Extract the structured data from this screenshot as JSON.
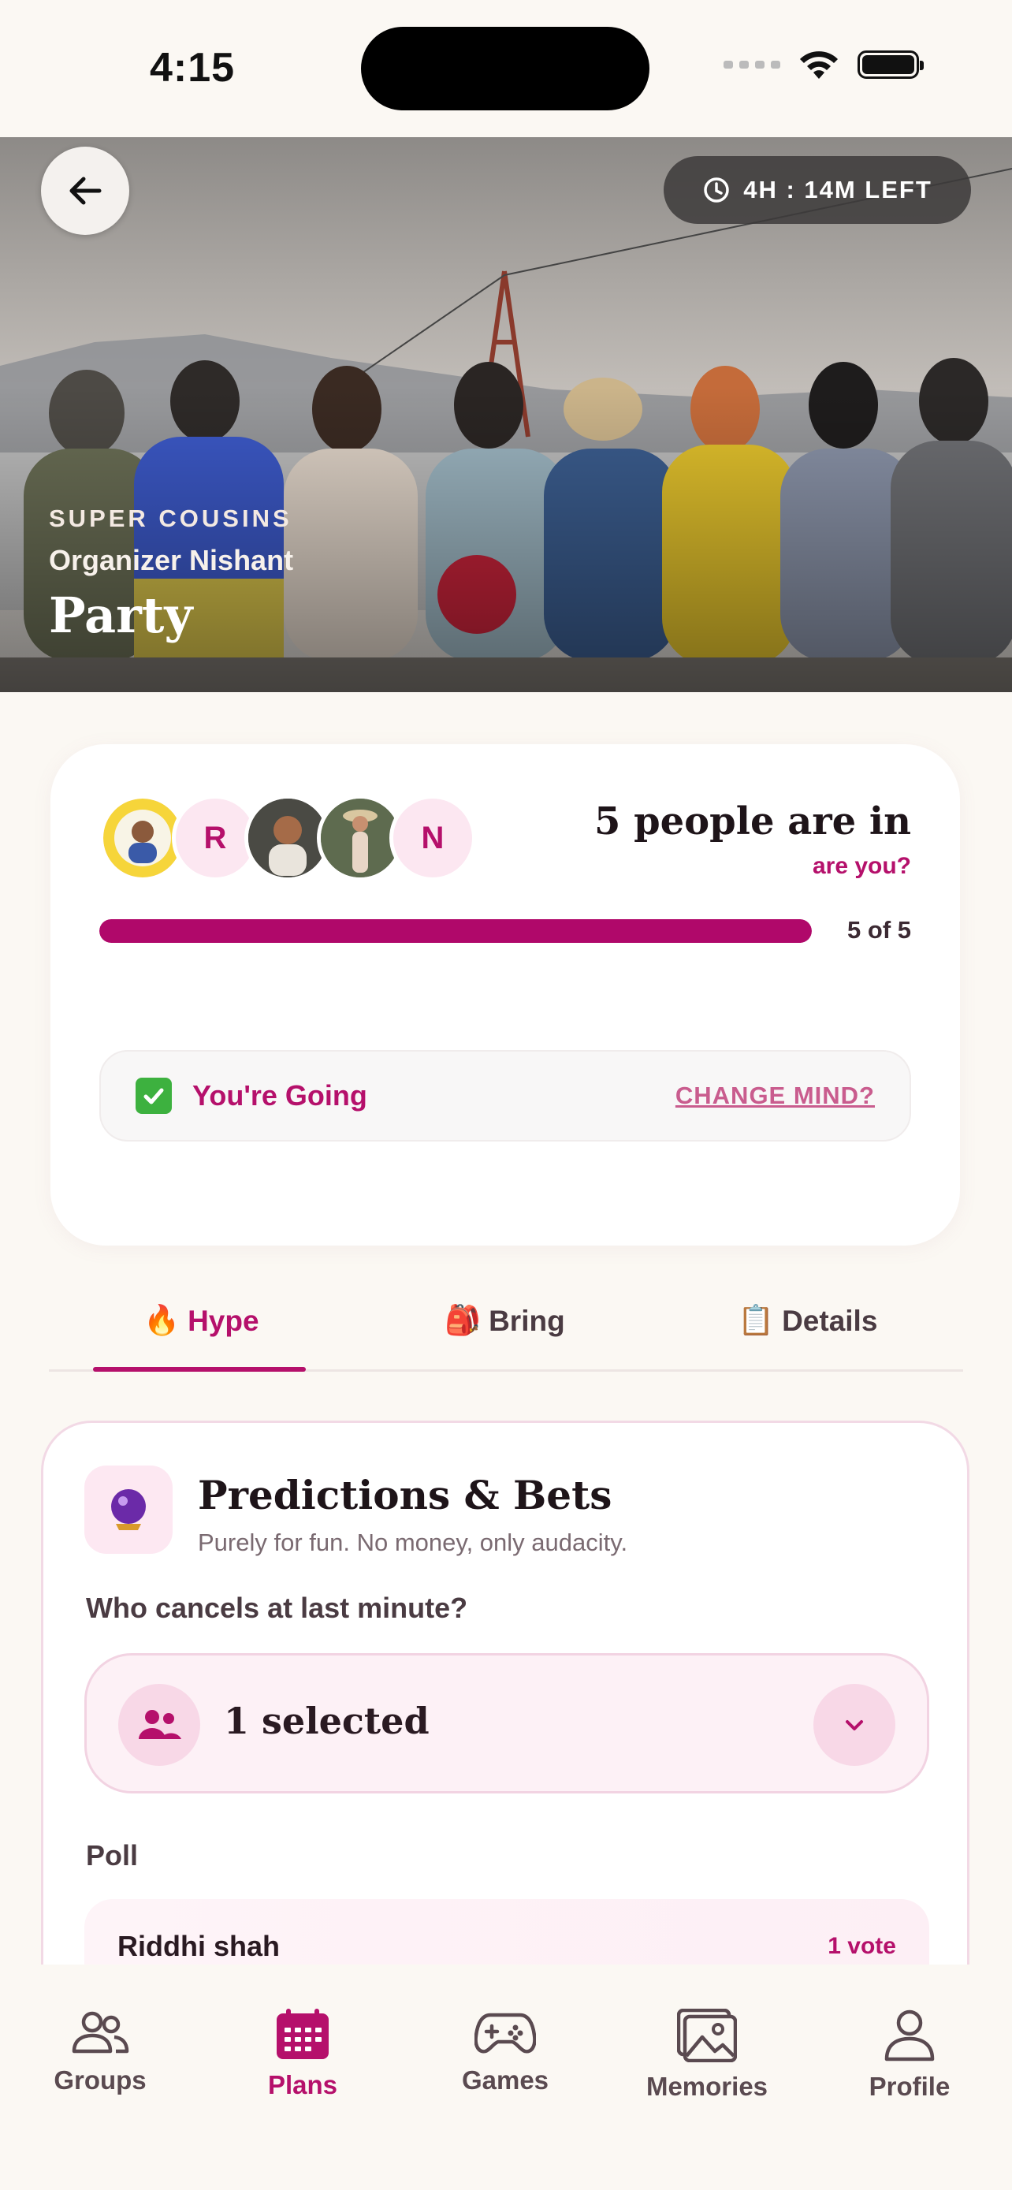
{
  "status_bar": {
    "time": "4:15"
  },
  "hero": {
    "timer": "4H : 14M LEFT",
    "group_name": "SUPER COUSINS",
    "organizer": "Organizer Nishant",
    "title": "Party"
  },
  "participation": {
    "avatars": [
      {
        "type": "photo",
        "initial": ""
      },
      {
        "type": "initial",
        "initial": "R"
      },
      {
        "type": "photo",
        "initial": ""
      },
      {
        "type": "photo",
        "initial": ""
      },
      {
        "type": "initial",
        "initial": "N"
      }
    ],
    "people_count": "5 people are in",
    "prompt": "are you?",
    "progress_fraction": 1.0,
    "progress_label": "5 of 5",
    "status_icon": "check-icon",
    "status_text": "You're Going",
    "change_label": "CHANGE MIND?"
  },
  "tabs": [
    {
      "emoji": "🔥",
      "label": "Hype",
      "active": true
    },
    {
      "emoji": "🎒",
      "label": "Bring",
      "active": false
    },
    {
      "emoji": "📋",
      "label": "Details",
      "active": false
    }
  ],
  "predictions": {
    "icon": "crystal-ball-icon",
    "title": "Predictions & Bets",
    "subtitle": "Purely for fun. No money, only audacity.",
    "question": "Who cancels at last minute?",
    "selection_text": "1 selected",
    "poll_label": "Poll",
    "poll_options": [
      {
        "name": "Riddhi shah",
        "votes": "1 vote"
      }
    ]
  },
  "bottom_nav": [
    {
      "label": "Groups",
      "icon": "groups-icon",
      "active": false
    },
    {
      "label": "Plans",
      "icon": "calendar-icon",
      "active": true
    },
    {
      "label": "Games",
      "icon": "gamepad-icon",
      "active": false
    },
    {
      "label": "Memories",
      "icon": "gallery-icon",
      "active": false
    },
    {
      "label": "Profile",
      "icon": "profile-icon",
      "active": false
    }
  ],
  "colors": {
    "accent": "#B5106B",
    "background": "#FBF8F3"
  }
}
